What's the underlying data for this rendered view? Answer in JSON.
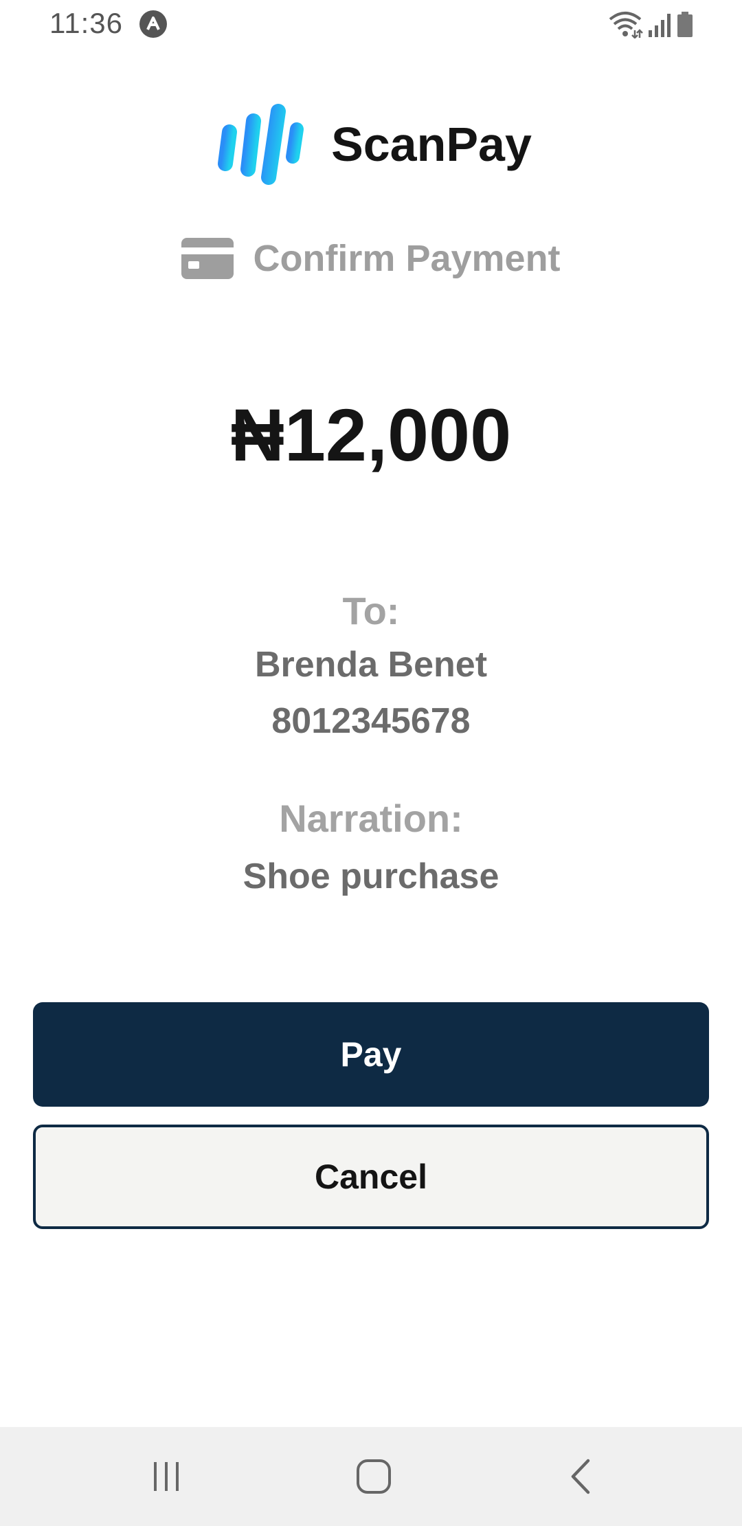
{
  "status_bar": {
    "time": "11:36",
    "icons": [
      "app-notification-icon",
      "wifi-icon",
      "signal-icon",
      "battery-icon"
    ]
  },
  "brand": {
    "name": "ScanPay",
    "logo_colors": [
      "#2a8ef7",
      "#1fd1ee"
    ]
  },
  "header": {
    "subtitle": "Confirm Payment",
    "icon": "credit-card-icon"
  },
  "payment": {
    "amount": "₦12,000",
    "to_label": "To:",
    "recipient_name": "Brenda Benet",
    "recipient_account": "8012345678",
    "narration_label": "Narration:",
    "narration": "Shoe purchase"
  },
  "actions": {
    "pay_label": "Pay",
    "cancel_label": "Cancel"
  },
  "colors": {
    "primary": "#0e2a44",
    "muted_label": "#a3a3a3",
    "muted_value": "#6b6b6b"
  },
  "nav_bar": {
    "icons": [
      "recent-apps-icon",
      "home-icon",
      "back-icon"
    ]
  }
}
